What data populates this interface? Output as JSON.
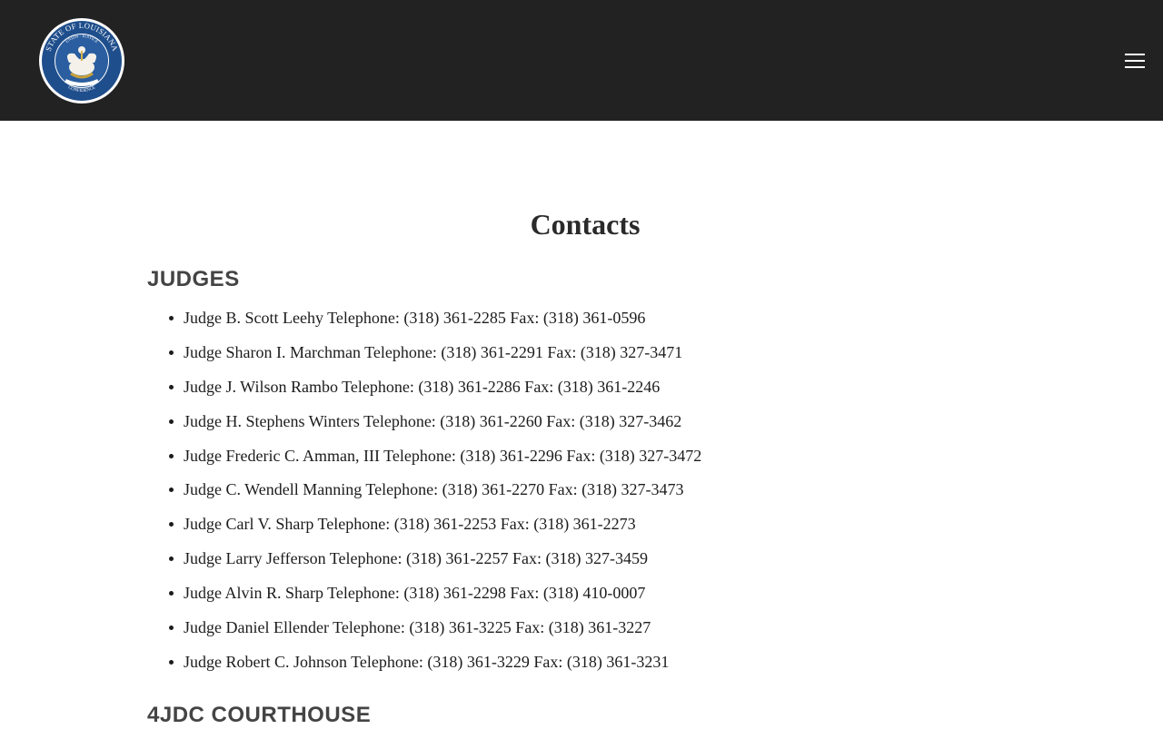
{
  "seal": {
    "top_text": "STATE OF LOUISIANA",
    "motto": "UNION · JUSTICE",
    "bottom_text": "CONFIDENCE"
  },
  "page": {
    "title": "Contacts"
  },
  "sections": {
    "judges_heading": "JUDGES",
    "courthouse_heading": "4JDC COURTHOUSE"
  },
  "judges": [
    "Judge B. Scott Leehy Telephone: (318) 361-2285 Fax: (318) 361-0596",
    "Judge Sharon I. Marchman Telephone: (318) 361-2291 Fax: (318) 327-3471",
    "Judge J. Wilson Rambo Telephone: (318) 361-2286 Fax: (318) 361-2246",
    "Judge H. Stephens Winters Telephone: (318) 361-2260 Fax: (318) 327-3462",
    "Judge Frederic C. Amman, III Telephone: (318) 361-2296 Fax: (318) 327-3472",
    "Judge C. Wendell Manning Telephone: (318) 361-2270 Fax: (318) 327-3473",
    "Judge Carl V. Sharp Telephone: (318) 361-2253 Fax: (318) 361-2273",
    "Judge Larry Jefferson Telephone: (318) 361-2257 Fax: (318) 327-3459",
    "Judge Alvin R. Sharp Telephone: (318) 361-2298 Fax: (318) 410-0007",
    "Judge Daniel Ellender Telephone: (318) 361-3225 Fax: (318) 361-3227",
    "Judge Robert C. Johnson Telephone: (318) 361-3229 Fax: (318) 361-3231"
  ],
  "colors": {
    "header_background": "#222222",
    "seal_blue": "#1f4e8c",
    "heading_gray": "#444444"
  },
  "icons": {
    "menu": "hamburger-menu-icon",
    "logo": "louisiana-state-seal-logo"
  }
}
